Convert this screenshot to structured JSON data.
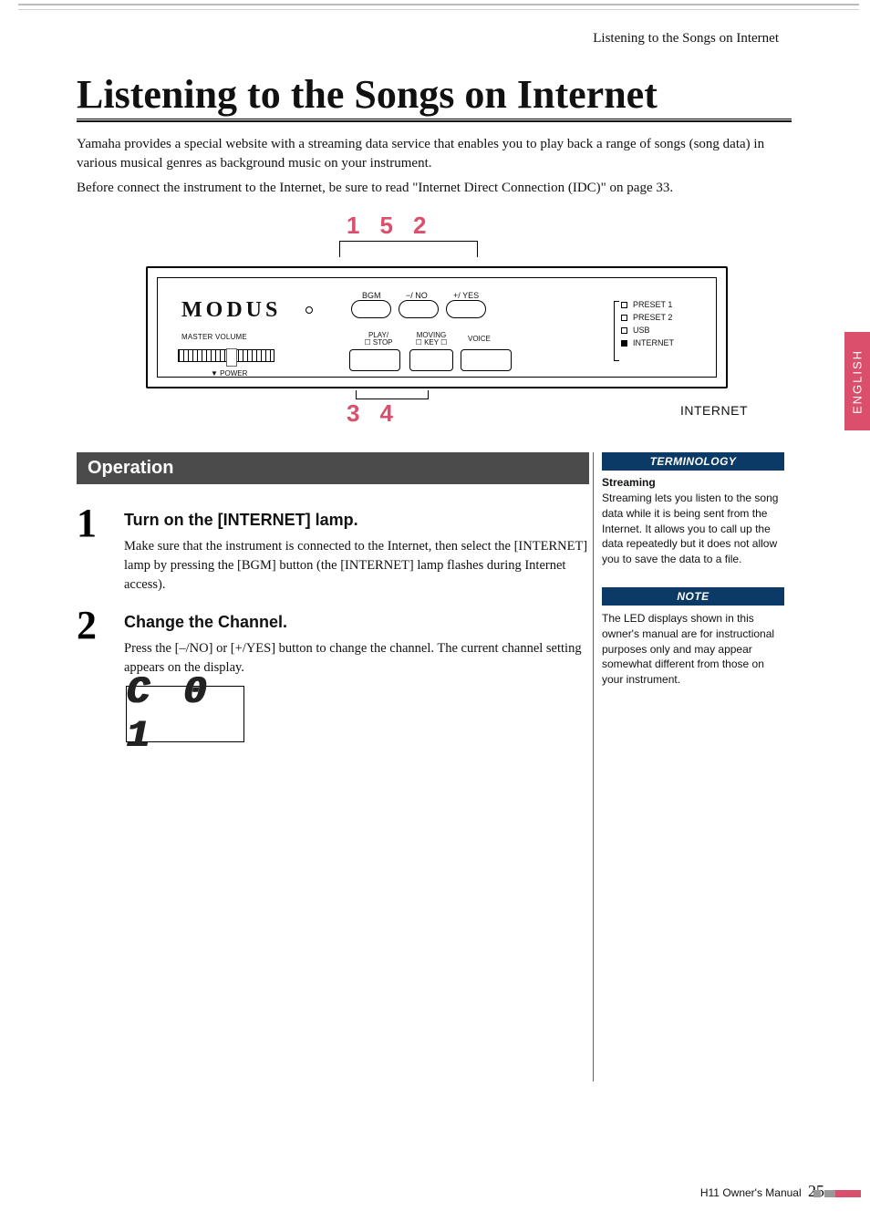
{
  "header": {
    "breadcrumb": "Listening to the Songs on Internet"
  },
  "title": "Listening to the Songs on Internet",
  "intro": {
    "p1": "Yamaha provides a special website with a streaming data service that enables you to play back a range of songs (song data) in various musical genres as background music on your instrument.",
    "p2": "Before connect the instrument to the Internet, be sure to read \"Internet Direct Connection (IDC)\" on page 33."
  },
  "panel": {
    "logo": "MODUS",
    "callouts_top": [
      "1",
      "5",
      "2"
    ],
    "callouts_bottom": [
      "3",
      "4"
    ],
    "buttons": {
      "bgm": "BGM",
      "no": "−/ NO",
      "yes": "+/ YES",
      "play": "PLAY/",
      "stop": "STOP",
      "moving": "MOVING",
      "key": "KEY",
      "voice": "VOICE"
    },
    "master_volume": "MASTER VOLUME",
    "power": "POWER",
    "lamps": {
      "preset1": "PRESET 1",
      "preset2": "PRESET 2",
      "usb": "USB",
      "internet": "INTERNET"
    },
    "internet_label": "INTERNET"
  },
  "side_tab": "ENGLISH",
  "operation": {
    "heading": "Operation",
    "steps": [
      {
        "num": "1",
        "title": "Turn on the [INTERNET] lamp.",
        "text": "Make sure that the instrument is connected to the Internet, then select the [INTERNET] lamp by pressing the [BGM] button (the [INTERNET] lamp flashes during Internet access)."
      },
      {
        "num": "2",
        "title": "Change the Channel.",
        "text": "Press the [–/NO] or [+/YES] button to change the channel. The current channel setting appears on the display."
      }
    ],
    "display_value": "C 0 1"
  },
  "sidebar": {
    "terminology": {
      "head": "TERMINOLOGY",
      "sub": "Streaming",
      "text": "Streaming lets you listen to the song data while it is being sent from the Internet. It allows you to call up the data repeatedly but it does not allow you to save the data to a file."
    },
    "note": {
      "head": "NOTE",
      "text": "The LED displays shown in this owner's manual are for instructional purposes only and may appear somewhat different from those on your instrument."
    }
  },
  "footer": {
    "text": "H11 Owner's Manual",
    "page": "25"
  }
}
